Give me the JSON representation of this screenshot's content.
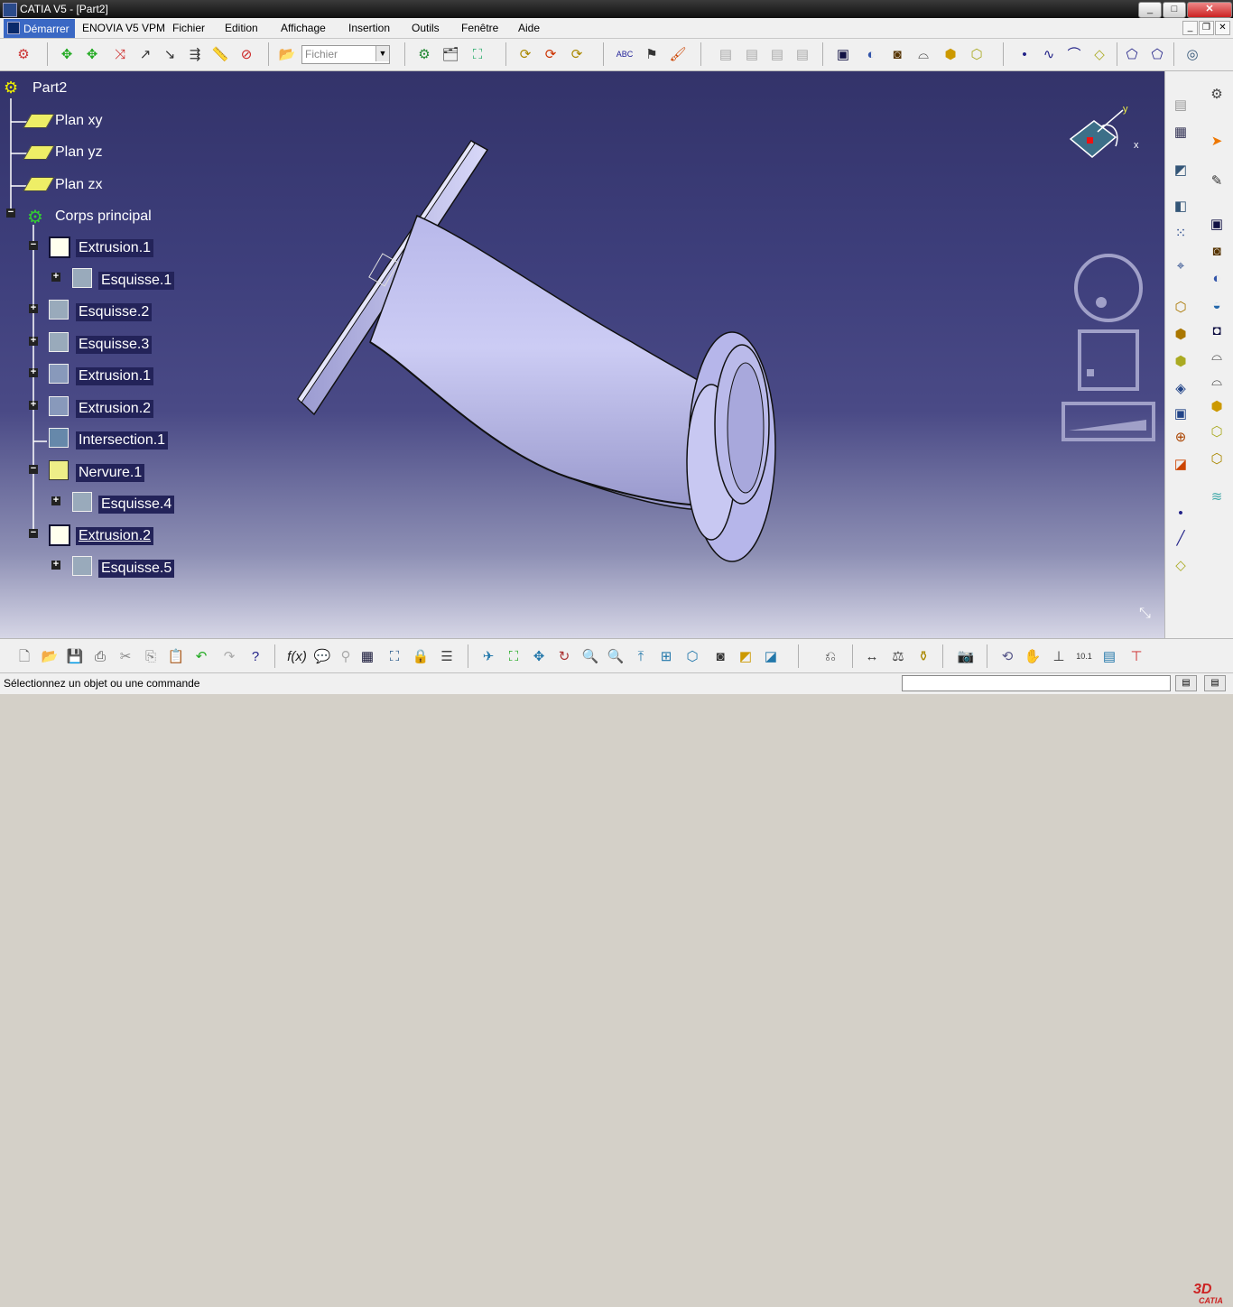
{
  "window": {
    "title": "CATIA V5 - [Part2]"
  },
  "menubar": {
    "items": [
      "Démarrer",
      "ENOVIA V5 VPM",
      "Fichier",
      "Edition",
      "Affichage",
      "Insertion",
      "Outils",
      "Fenêtre",
      "Aide"
    ]
  },
  "toolbar": {
    "file_combo": "Fichier"
  },
  "tree": {
    "root": "Part2",
    "nodes": [
      "Plan xy",
      "Plan yz",
      "Plan zx",
      "Corps principal",
      "Extrusion.1",
      "Esquisse.1",
      "Esquisse.2",
      "Esquisse.3",
      "Extrusion.1",
      "Extrusion.2",
      "Intersection.1",
      "Nervure.1",
      "Esquisse.4",
      "Extrusion.2",
      "Esquisse.5"
    ]
  },
  "compass": {
    "x_label": "x",
    "y_label": "y"
  },
  "status": {
    "message": "Sélectionnez un objet ou une commande"
  },
  "logo": {
    "text": "CATIA"
  },
  "colors": {
    "viewport_top": "#33336a",
    "viewport_bottom": "#d6d6e6",
    "part": "#c8c8f2",
    "menu_active": "#3a68c4"
  }
}
